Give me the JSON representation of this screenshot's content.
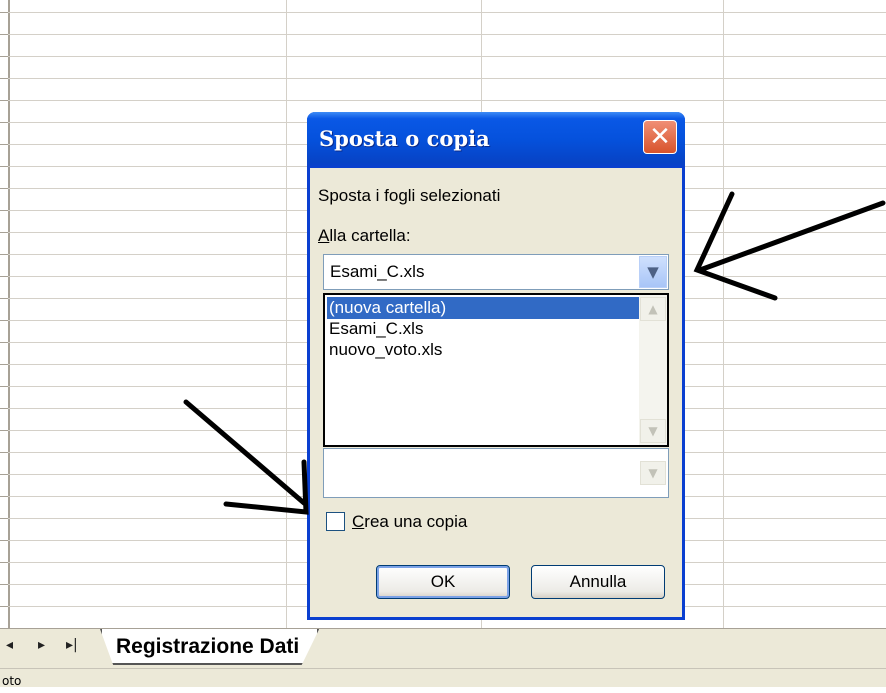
{
  "sheet": {
    "tab_label": "Registrazione Dati",
    "nav_first": "◂",
    "nav_next": "▸",
    "nav_last": "▸|",
    "status_text": "oto"
  },
  "dialog": {
    "title": "Sposta o copia",
    "close_glyph": "✕",
    "subtitle": "Sposta i fogli selezionati",
    "to_book_label_mnemonic": "A",
    "to_book_label_rest": "lla cartella:",
    "to_book_value": "Esami_C.xls",
    "list_items": [
      "(nuova cartella)",
      "Esami_C.xls",
      "nuovo_voto.xls"
    ],
    "copy_label_mnemonic": "C",
    "copy_label_rest": "rea una copia",
    "copy_checked": false,
    "ok_label": "OK",
    "cancel_label": "Annulla"
  },
  "colors": {
    "title_bar": "#0551dc",
    "dialog_bg": "#ece9d8",
    "selection": "#316ac5",
    "close_button": "#d8532c"
  },
  "annotations": [
    "arrow-pointing-to-dropdown",
    "arrow-pointing-to-checkbox"
  ]
}
